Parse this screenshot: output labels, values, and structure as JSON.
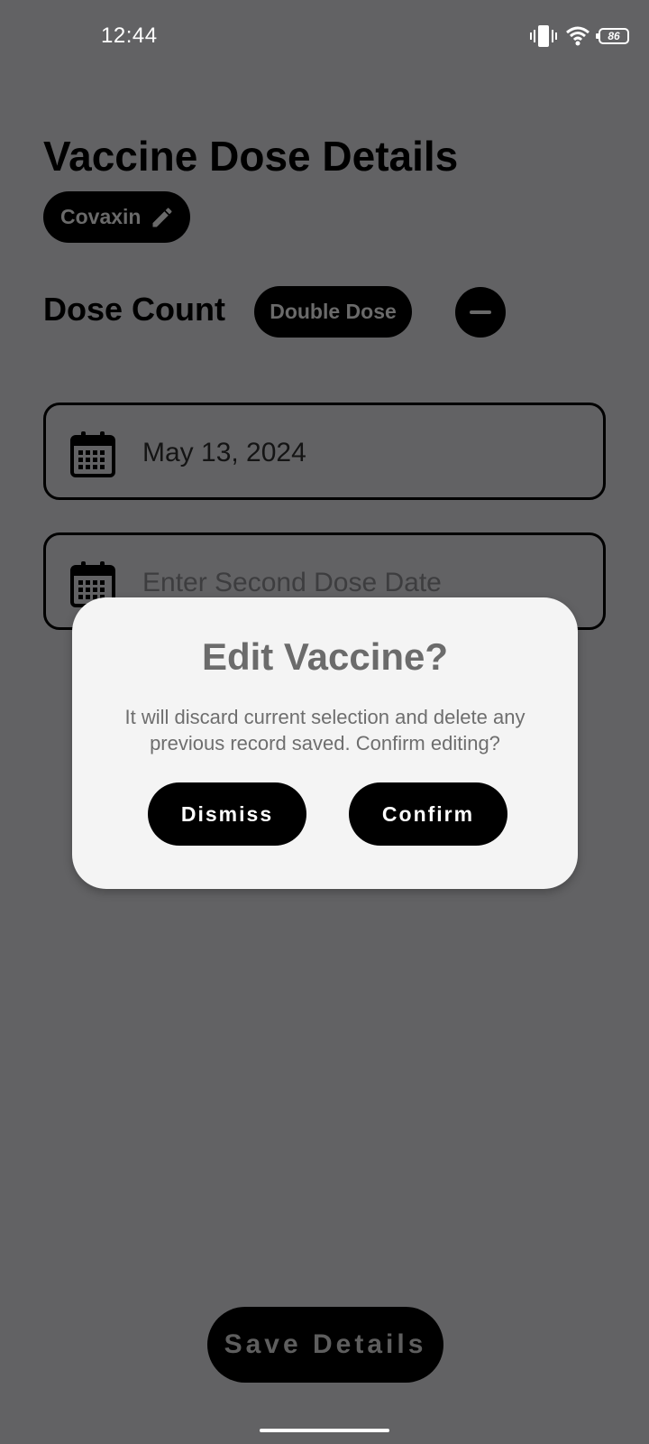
{
  "status_bar": {
    "time": "12:44",
    "battery_level": "86",
    "icons": [
      "vibrate-icon",
      "wifi-icon",
      "battery-icon"
    ]
  },
  "page": {
    "title": "Vaccine Dose Details",
    "vaccine_name": "Covaxin",
    "dose_count_label": "Dose Count",
    "dose_type": "Double Dose"
  },
  "first_dose": {
    "value": "May 13, 2024"
  },
  "second_dose": {
    "placeholder": "Enter Second Dose Date"
  },
  "dialog": {
    "title": "Edit Vaccine?",
    "message": "It will discard current selection and delete any previous record saved. Confirm editing?",
    "dismiss_label": "Dismiss",
    "confirm_label": "Confirm"
  },
  "footer": {
    "save_label": "Save Details"
  },
  "colors": {
    "overlay_background": "#626264",
    "dialog_background": "#f4f4f4",
    "button_background": "#000000"
  }
}
